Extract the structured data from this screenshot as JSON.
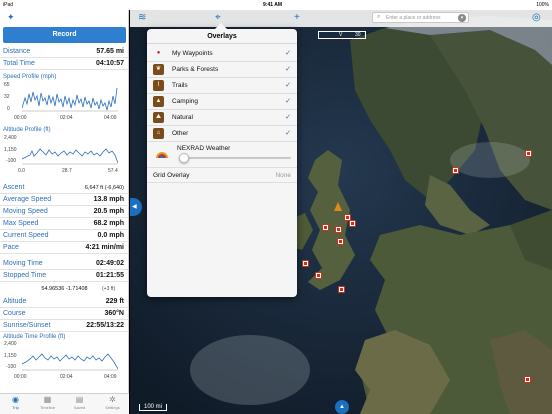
{
  "status": {
    "carrier": "iPad",
    "time": "9:41 AM",
    "battery": "100%"
  },
  "sidebar": {
    "record_label": "Record",
    "stats1": [
      {
        "label": "Distance",
        "value": "57.65 mi"
      },
      {
        "label": "Total Time",
        "value": "04:10:57"
      }
    ],
    "speed_profile": {
      "title": "Speed Profile (mph)",
      "y_ticks": [
        "65",
        "32",
        "0"
      ],
      "x_ticks": [
        "00:00",
        "02:04",
        "04:09"
      ]
    },
    "altitude_profile": {
      "title": "Altitude Profile (ft)",
      "y_ticks": [
        "2,400",
        "1,150",
        "-100"
      ],
      "x_ticks": [
        "0.0",
        "28.7",
        "57.4"
      ]
    },
    "ascent": {
      "label": "Ascent",
      "value": "6,647 ft (-6,640)"
    },
    "stats2": [
      {
        "label": "Average Speed",
        "value": "13.8 mph"
      },
      {
        "label": "Moving Speed",
        "value": "20.5 mph"
      },
      {
        "label": "Max Speed",
        "value": "68.2 mph"
      },
      {
        "label": "Current Speed",
        "value": "0.0 mph"
      },
      {
        "label": "Pace",
        "value": "4:21 min/mi"
      },
      {
        "label": "Moving Time",
        "value": "02:49:02"
      },
      {
        "label": "Stopped Time",
        "value": "01:21:55"
      }
    ],
    "coordinates": "54.96536 -1.71408",
    "accuracy": "(+3 ft)",
    "stats3": [
      {
        "label": "Altitude",
        "value": "229 ft"
      },
      {
        "label": "Course",
        "value": "360°N"
      },
      {
        "label": "Sunrise/Sunset",
        "value": "22:55/13:22"
      }
    ],
    "altitude_time": {
      "title": "Altitude Time Profile (ft)",
      "y_ticks": [
        "2,400",
        "1,150",
        "-100"
      ],
      "x_ticks": [
        "00:00",
        "02:04",
        "04:09"
      ]
    }
  },
  "tabs": [
    {
      "label": "Trip",
      "icon": "trip-gauge-icon"
    },
    {
      "label": "Timeline",
      "icon": "timeline-grid-icon"
    },
    {
      "label": "Saved",
      "icon": "saved-list-icon"
    },
    {
      "label": "Settings",
      "icon": "gear-icon"
    }
  ],
  "map": {
    "search_placeholder": "Enter a place or address",
    "scale_mid": "V",
    "scale_right": "30",
    "map_scale_label": "100 mi"
  },
  "overlays": {
    "title": "Overlays",
    "items": [
      {
        "label": "My Waypoints",
        "icon": "waypoint-pin-icon",
        "checked": true
      },
      {
        "label": "Parks & Forests",
        "icon": "leaf-icon",
        "checked": true
      },
      {
        "label": "Trails",
        "icon": "trail-icon",
        "checked": true
      },
      {
        "label": "Camping",
        "icon": "tent-icon",
        "checked": true
      },
      {
        "label": "Natural",
        "icon": "mountain-icon",
        "checked": true
      },
      {
        "label": "Other",
        "icon": "house-icon",
        "checked": true
      }
    ],
    "weather_label": "NEXRAD Weather",
    "grid_label": "Grid Overlay",
    "grid_value": "None",
    "check_glyph": "✓"
  },
  "colors": {
    "accent": "#1a6fc0",
    "sidebar_label": "#2e6fb8",
    "marker": "#d0301a",
    "overlay_icon": "#7a4c1a"
  }
}
